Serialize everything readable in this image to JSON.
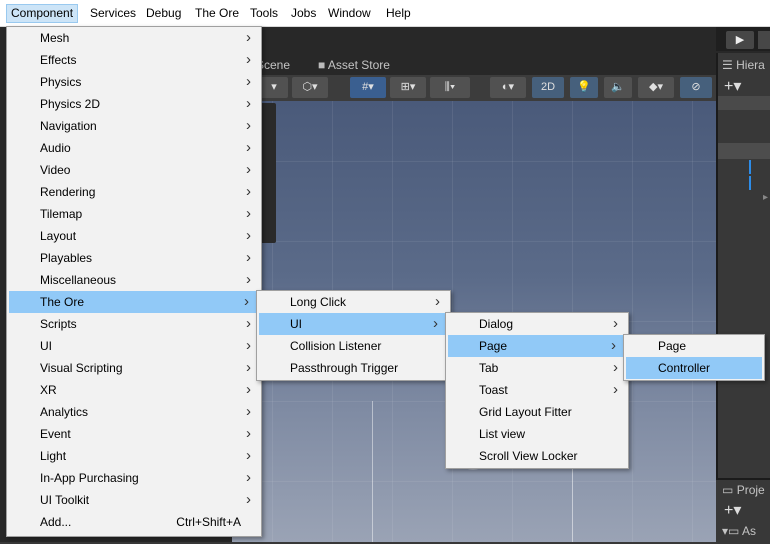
{
  "menubar": {
    "items": [
      "Component",
      "Services",
      "Debug",
      "The Ore",
      "Tools",
      "Jobs",
      "Window",
      "Help"
    ],
    "active": "Component"
  },
  "editor": {
    "tabs": {
      "scene": "Scene",
      "asset_store": "Asset Store"
    },
    "toolbar": {
      "mode_2d": "2D"
    },
    "hierarchy_title": "Hiera",
    "project_title": "Proje",
    "assets_label": "As"
  },
  "component_menu": {
    "items": [
      {
        "label": "Mesh",
        "submenu": true
      },
      {
        "label": "Effects",
        "submenu": true
      },
      {
        "label": "Physics",
        "submenu": true
      },
      {
        "label": "Physics 2D",
        "submenu": true
      },
      {
        "label": "Navigation",
        "submenu": true
      },
      {
        "label": "Audio",
        "submenu": true
      },
      {
        "label": "Video",
        "submenu": true
      },
      {
        "label": "Rendering",
        "submenu": true
      },
      {
        "label": "Tilemap",
        "submenu": true
      },
      {
        "label": "Layout",
        "submenu": true
      },
      {
        "label": "Playables",
        "submenu": true
      },
      {
        "label": "Miscellaneous",
        "submenu": true
      },
      {
        "label": "The Ore",
        "submenu": true,
        "highlighted": true
      },
      {
        "label": "Scripts",
        "submenu": true
      },
      {
        "label": "UI",
        "submenu": true
      },
      {
        "label": "Visual Scripting",
        "submenu": true
      },
      {
        "label": "XR",
        "submenu": true
      },
      {
        "label": "Analytics",
        "submenu": true
      },
      {
        "label": "Event",
        "submenu": true
      },
      {
        "label": "Light",
        "submenu": true
      },
      {
        "label": "In-App Purchasing",
        "submenu": true
      },
      {
        "label": "UI Toolkit",
        "submenu": true
      },
      {
        "label": "Add...",
        "submenu": false,
        "shortcut": "Ctrl+Shift+A"
      }
    ]
  },
  "the_ore_menu": {
    "items": [
      {
        "label": "Long Click",
        "submenu": true
      },
      {
        "label": "UI",
        "submenu": true,
        "highlighted": true
      },
      {
        "label": "Collision Listener",
        "submenu": false
      },
      {
        "label": "Passthrough Trigger",
        "submenu": false
      }
    ]
  },
  "ui_menu": {
    "items": [
      {
        "label": "Dialog",
        "submenu": true
      },
      {
        "label": "Page",
        "submenu": true,
        "highlighted": true
      },
      {
        "label": "Tab",
        "submenu": true
      },
      {
        "label": "Toast",
        "submenu": true
      },
      {
        "label": "Grid Layout Fitter",
        "submenu": false
      },
      {
        "label": "List view",
        "submenu": false
      },
      {
        "label": "Scroll View Locker",
        "submenu": false
      }
    ]
  },
  "page_menu": {
    "items": [
      {
        "label": "Page",
        "submenu": false
      },
      {
        "label": "Controller",
        "submenu": false,
        "highlighted": true
      }
    ]
  },
  "colors": {
    "menu_bg": "#f2f2f2",
    "highlight": "#91c9f7",
    "menubar_active": "#cce4f7"
  }
}
